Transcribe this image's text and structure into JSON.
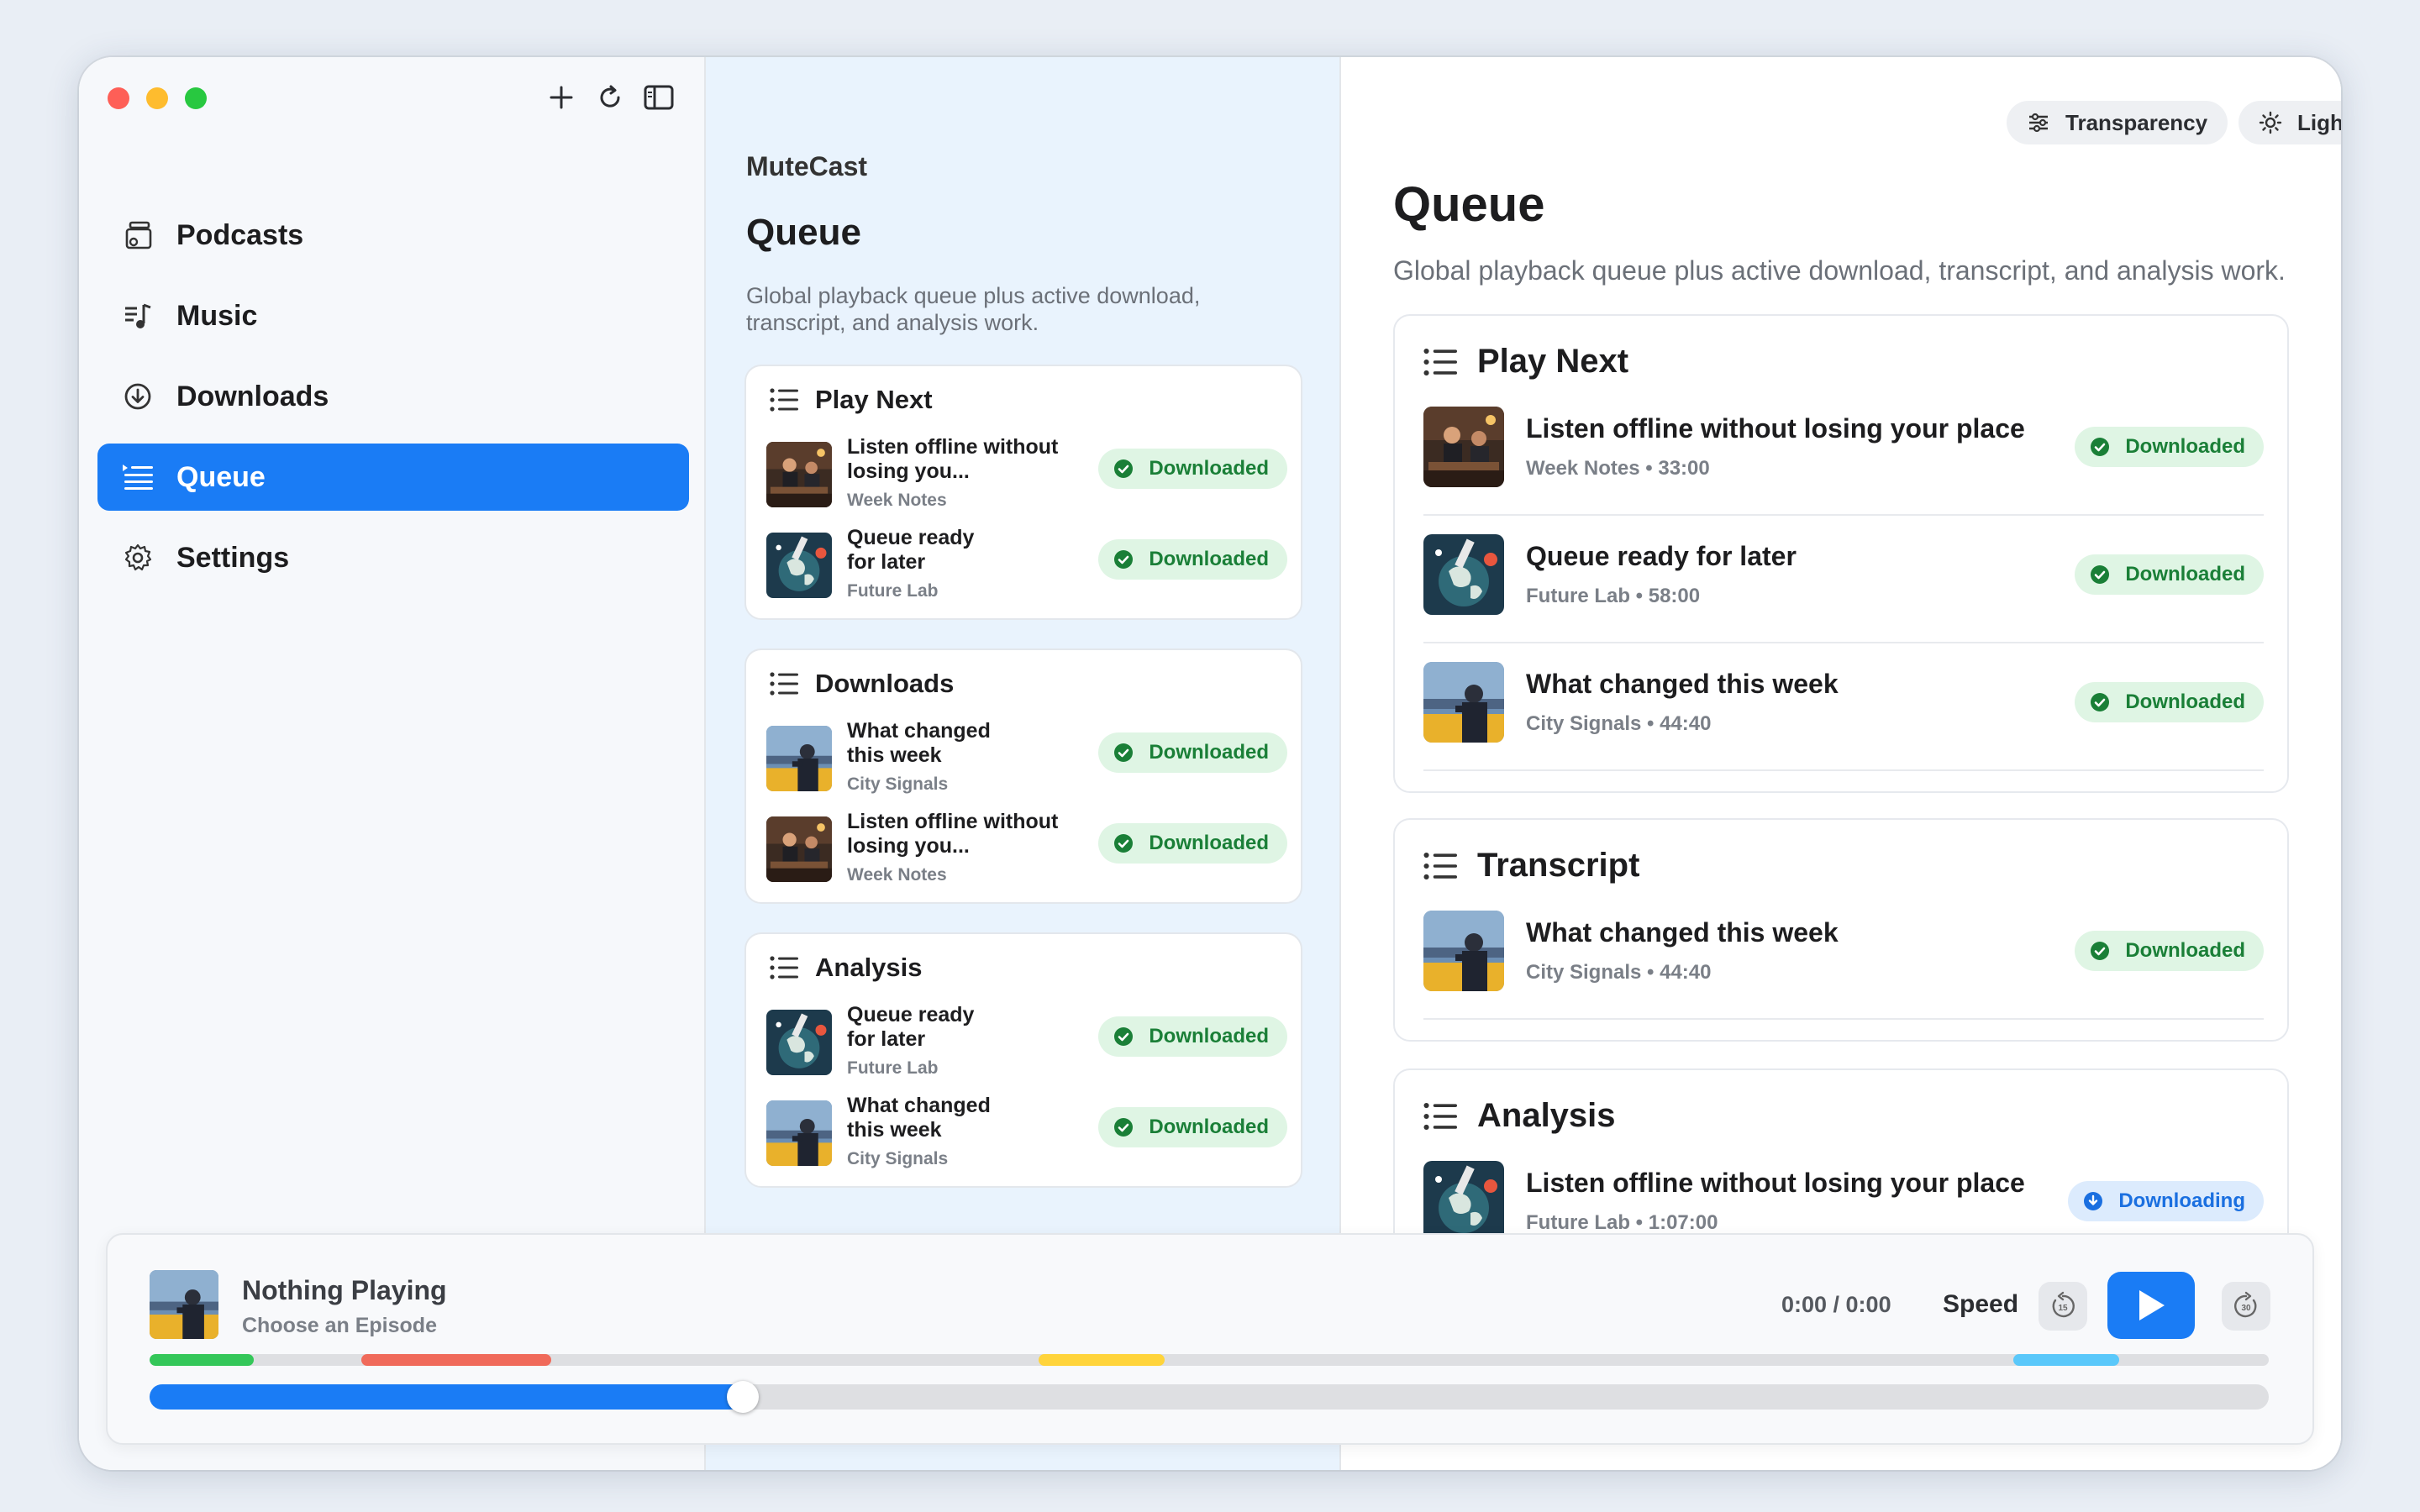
{
  "sidebar": {
    "items": [
      {
        "label": "Podcasts",
        "icon": "podcasts-icon"
      },
      {
        "label": "Music",
        "icon": "music-icon"
      },
      {
        "label": "Downloads",
        "icon": "downloads-icon"
      },
      {
        "label": "Queue",
        "icon": "queue-icon",
        "active": true
      },
      {
        "label": "Settings",
        "icon": "gear-icon"
      }
    ]
  },
  "middle": {
    "app_name": "MuteCast",
    "title": "Queue",
    "description": "Global playback queue plus active download, transcript, and analysis work.",
    "sections": [
      {
        "heading": "Play Next",
        "rows": [
          {
            "title": "Listen offline without losing you...",
            "show": "Week Notes",
            "status": "Downloaded"
          },
          {
            "title": "Queue ready for later",
            "show": "Future Lab",
            "status": "Downloaded"
          }
        ]
      },
      {
        "heading": "Downloads",
        "rows": [
          {
            "title": "What changed this week",
            "show": "City Signals",
            "status": "Downloaded"
          },
          {
            "title": "Listen offline without losing you...",
            "show": "Week Notes",
            "status": "Downloaded"
          }
        ]
      },
      {
        "heading": "Analysis",
        "rows": [
          {
            "title": "Queue ready for later",
            "show": "Future Lab",
            "status": "Downloaded"
          },
          {
            "title": "What changed this week",
            "show": "City Signals",
            "status": "Downloaded"
          }
        ]
      }
    ]
  },
  "right": {
    "transparency_label": "Transparency",
    "theme_label": "Light",
    "title": "Queue",
    "description": "Global playback queue plus active download, transcript, and analysis work.",
    "sections": [
      {
        "heading": "Play Next",
        "rows": [
          {
            "title": "Listen offline without losing your place",
            "meta": "Week Notes • 33:00",
            "status": "Downloaded"
          },
          {
            "title": "Queue ready for later",
            "meta": "Future Lab • 58:00",
            "status": "Downloaded"
          },
          {
            "title": "What changed this week",
            "meta": "City Signals • 44:40",
            "status": "Downloaded"
          }
        ]
      },
      {
        "heading": "Transcript",
        "rows": [
          {
            "title": "What changed this week",
            "meta": "City Signals • 44:40",
            "status": "Downloaded"
          }
        ]
      },
      {
        "heading": "Analysis",
        "rows": [
          {
            "title": "Listen offline without losing your place",
            "meta": "Future Lab • 1:07:00",
            "status": "Downloading"
          }
        ]
      }
    ]
  },
  "player": {
    "title": "Nothing Playing",
    "subtitle": "Choose an Episode",
    "time": "0:00 / 0:00",
    "speed_label": "Speed",
    "skip_back": "15",
    "skip_forward": "30",
    "progress_fraction": 0.28
  },
  "colors": {
    "accent": "#1a7cf5",
    "downloaded_bg": "#dff5e4",
    "downloaded_fg": "#1a7f37",
    "downloading_bg": "#dcebfd",
    "downloading_fg": "#1a6fe0",
    "segment_green": "#34c759",
    "segment_red": "#f06a5a",
    "segment_yellow": "#ffd43b",
    "segment_cyan": "#5ac8fa"
  }
}
